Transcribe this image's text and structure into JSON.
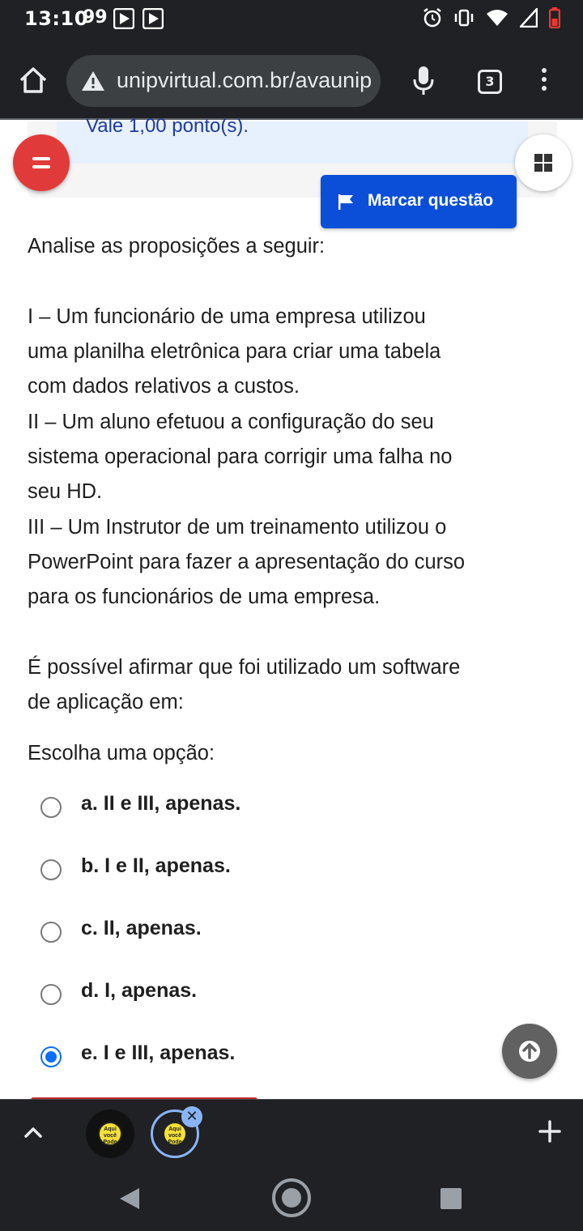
{
  "status_bar": {
    "time": "13:10",
    "notification_count": "99",
    "icons": [
      "play-icon",
      "play-icon",
      "alarm-icon",
      "vibrate-icon",
      "wifi-icon",
      "signal-icon",
      "battery-low-icon"
    ]
  },
  "browser": {
    "url": "unipvirtual.com.br/avaunip",
    "tab_count": "3"
  },
  "question": {
    "points": "Vale 1,00 ponto(s).",
    "mark_label": "Marcar questão",
    "lines": [
      "Analise as proposições a seguir:",
      "I – Um funcionário de uma empresa utilizou",
      "uma planilha eletrônica para criar uma tabela",
      "com dados relativos a custos.",
      "II – Um aluno efetuou a configuração do seu",
      "sistema operacional para corrigir uma falha no",
      "seu HD.",
      "III – Um Instrutor de um treinamento utilizou o",
      "PowerPoint para fazer a apresentação do curso",
      "para os funcionários de uma empresa.",
      "É possível afirmar que foi utilizado um software",
      "de aplicação em:",
      "Escolha uma opção:"
    ],
    "options": [
      {
        "label": "a. II e III, apenas.",
        "selected": false
      },
      {
        "label": "b. I e II, apenas.",
        "selected": false
      },
      {
        "label": "c. II, apenas.",
        "selected": false
      },
      {
        "label": "d. I, apenas.",
        "selected": false
      },
      {
        "label": "e. I e III, apenas.",
        "selected": true
      }
    ]
  },
  "tab_strip": {
    "favicon_text": "Aqui você Pode"
  },
  "colors": {
    "accent": "#0b4fd8",
    "radio_selected": "#0d6efd",
    "danger": "#e13a3a",
    "toolbar_bg": "#202124"
  }
}
